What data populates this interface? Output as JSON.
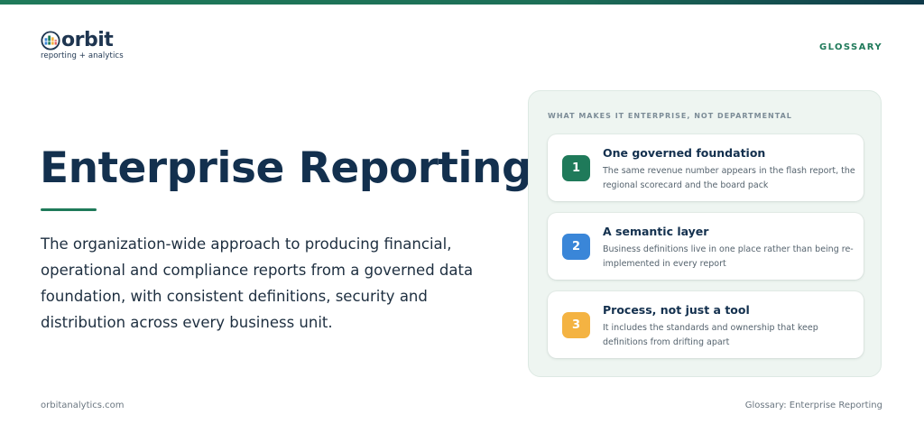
{
  "brand": {
    "name": "orbit",
    "tagline": "reporting + analytics",
    "logo_icon": "orbit-globe-logo-icon"
  },
  "header": {
    "section": "GLOSSARY"
  },
  "hero": {
    "title": "Enterprise Reporting",
    "definition": "The organization-wide approach to producing financial, operational and compliance reports from a governed data foundation, with consistent definitions, security and distribution across every business unit."
  },
  "panel": {
    "label": "WHAT MAKES IT ENTERPRISE, NOT DEPARTMENTAL",
    "items": [
      {
        "number": "1",
        "title": "One governed foundation",
        "description": "The same revenue number appears in the flash report, the regional scorecard and the board pack",
        "color": "#1f7a5a"
      },
      {
        "number": "2",
        "title": "A semantic layer",
        "description": "Business definitions live in one place rather than being re-implemented in every report",
        "color": "#3a86d8"
      },
      {
        "number": "3",
        "title": "Process, not just a tool",
        "description": "It includes the standards and ownership that keep definitions from drifting apart",
        "color": "#f4b342"
      }
    ]
  },
  "footer": {
    "website": "orbitanalytics.com",
    "page_label": "Glossary: Enterprise Reporting"
  },
  "colors": {
    "primary_green": "#1f7a5a",
    "navy": "#13304e",
    "panel_bg": "#eef5f1"
  }
}
